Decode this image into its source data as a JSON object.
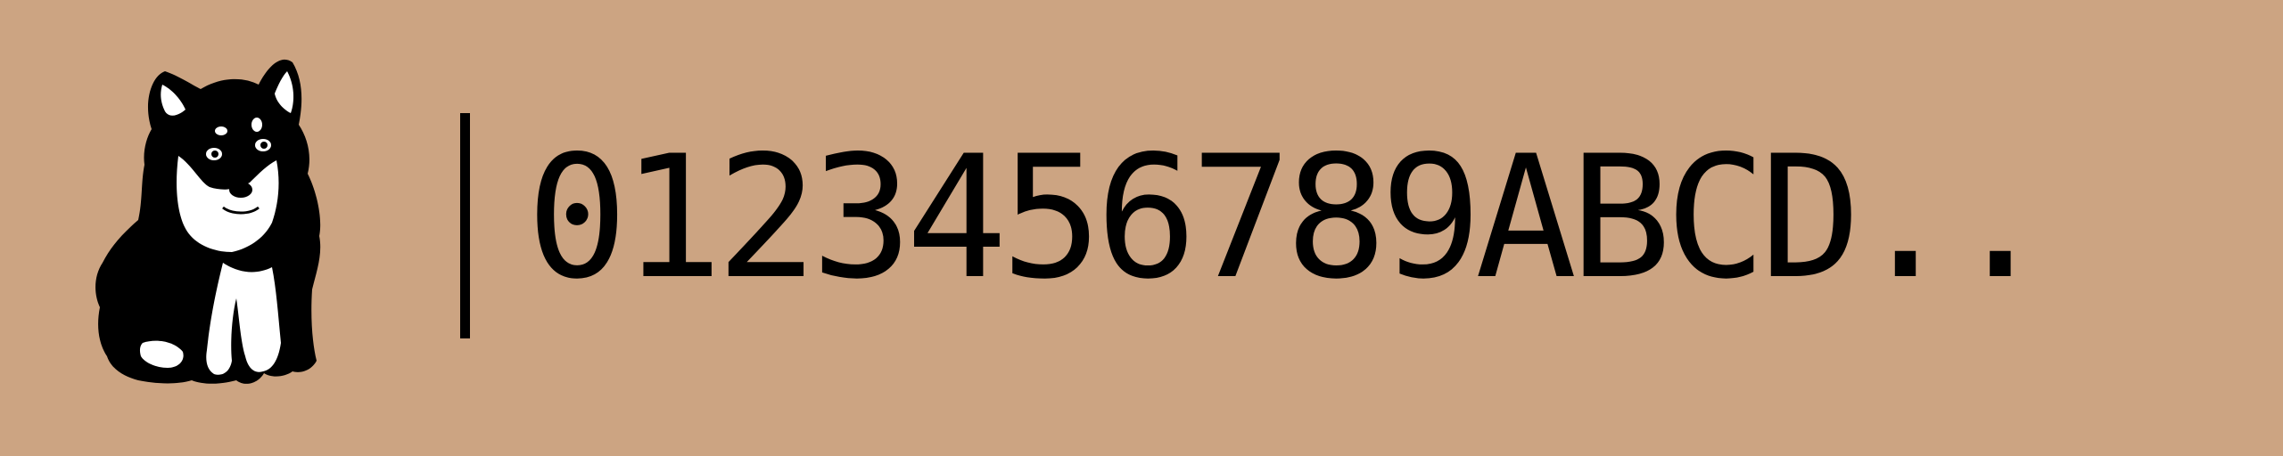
{
  "banner": {
    "sample_text": "0123456789ABCD..",
    "background_color": "#cca482",
    "text_color": "#000000"
  },
  "logo": {
    "icon": "puppy-icon"
  }
}
